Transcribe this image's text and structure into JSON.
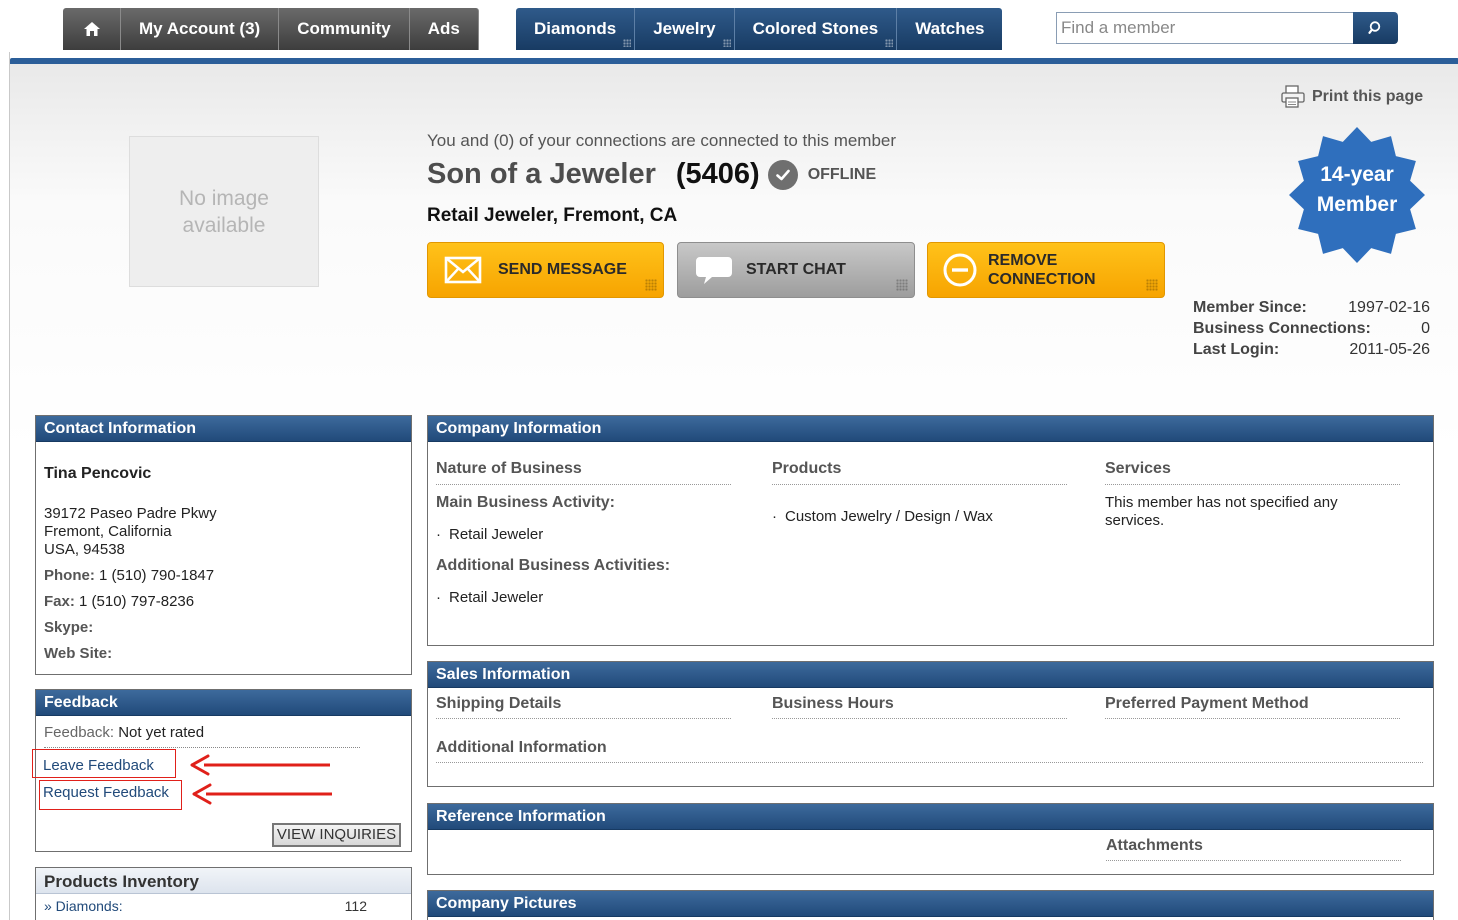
{
  "nav": {
    "left_tabs": [
      "My Account (3)",
      "Community",
      "Ads"
    ],
    "right_tabs": [
      "Diamonds",
      "Jewelry",
      "Colored Stones",
      "Watches"
    ],
    "search_placeholder": "Find a member"
  },
  "header": {
    "print_label": "Print this page",
    "no_image": "No image available",
    "connections_line": "You and (0) of your connections are connected to this member",
    "member_name": "Son of a Jeweler",
    "member_count": "(5406)",
    "status": "OFFLINE",
    "subtitle": "Retail Jeweler, Fremont, CA",
    "badge": [
      "14-year",
      "Member"
    ],
    "buttons": {
      "send_message": "SEND MESSAGE",
      "start_chat": "START CHAT",
      "remove_connection_1": "REMOVE",
      "remove_connection_2": "CONNECTION"
    },
    "stats": [
      {
        "label": "Member Since:",
        "value": "1997-02-16"
      },
      {
        "label": "Business Connections:",
        "value": "0"
      },
      {
        "label": "Last Login:",
        "value": "2011-05-26"
      }
    ]
  },
  "contact": {
    "title": "Contact Information",
    "name": "Tina Pencovic",
    "address": [
      "39172 Paseo Padre Pkwy",
      "Fremont,  California",
      "USA,  94538"
    ],
    "phone_label": "Phone:",
    "phone": "1  (510) 790-1847",
    "fax_label": "Fax:",
    "fax": "1  (510) 797-8236",
    "skype_label": "Skype:",
    "web_label": "Web Site:"
  },
  "feedback": {
    "title": "Feedback",
    "label": "Feedback:",
    "value": "Not yet rated",
    "leave": "Leave Feedback",
    "request": "Request Feedback",
    "view_inquiries": "VIEW INQUIRIES"
  },
  "inventory": {
    "title": "Products Inventory",
    "items": [
      {
        "label": "» Diamonds:",
        "value": "112"
      }
    ]
  },
  "company": {
    "title": "Company Information",
    "nature_h": "Nature of Business",
    "main_activity_h": "Main Business Activity:",
    "main_activity": "Retail Jeweler",
    "additional_h": "Additional Business Activities:",
    "additional": "Retail Jeweler",
    "products_h": "Products",
    "products": "Custom Jewelry / Design / Wax",
    "services_h": "Services",
    "services": "This member has not specified any services."
  },
  "sales": {
    "title": "Sales Information",
    "shipping": "Shipping Details",
    "hours": "Business Hours",
    "payment": "Preferred Payment Method",
    "additional": "Additional Information"
  },
  "reference": {
    "title": "Reference Information",
    "attachments": "Attachments"
  },
  "pictures": {
    "title": "Company Pictures"
  }
}
